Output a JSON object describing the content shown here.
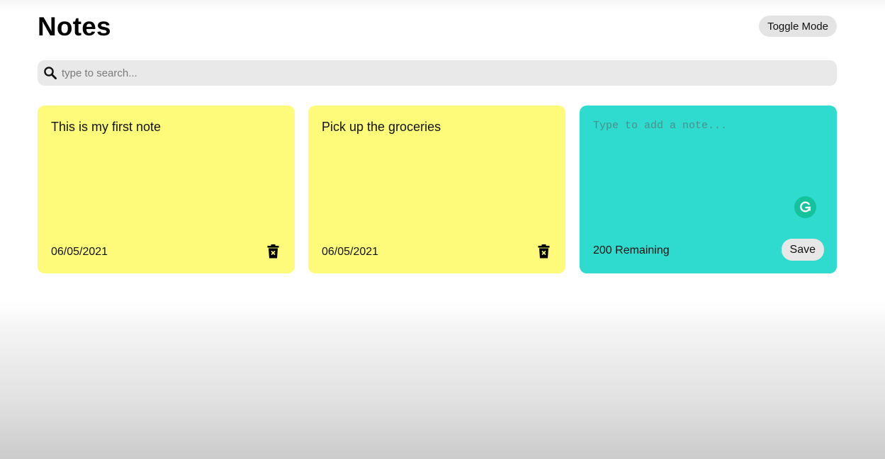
{
  "header": {
    "title": "Notes",
    "toggle_label": "Toggle Mode"
  },
  "search": {
    "placeholder": "type to search...",
    "value": "",
    "icon": "search-icon"
  },
  "notes": [
    {
      "text": "This is my first note",
      "date": "06/05/2021",
      "color": "#fdfb79",
      "delete_icon": "trash-icon"
    },
    {
      "text": "Pick up the groceries",
      "date": "06/05/2021",
      "color": "#fdfb79",
      "delete_icon": "trash-icon"
    }
  ],
  "new_note": {
    "placeholder": "Type to add a note...",
    "value": "",
    "remaining_label": "200 Remaining",
    "save_label": "Save",
    "color": "#2fdbcf",
    "assistant_icon": "grammarly-icon"
  }
}
